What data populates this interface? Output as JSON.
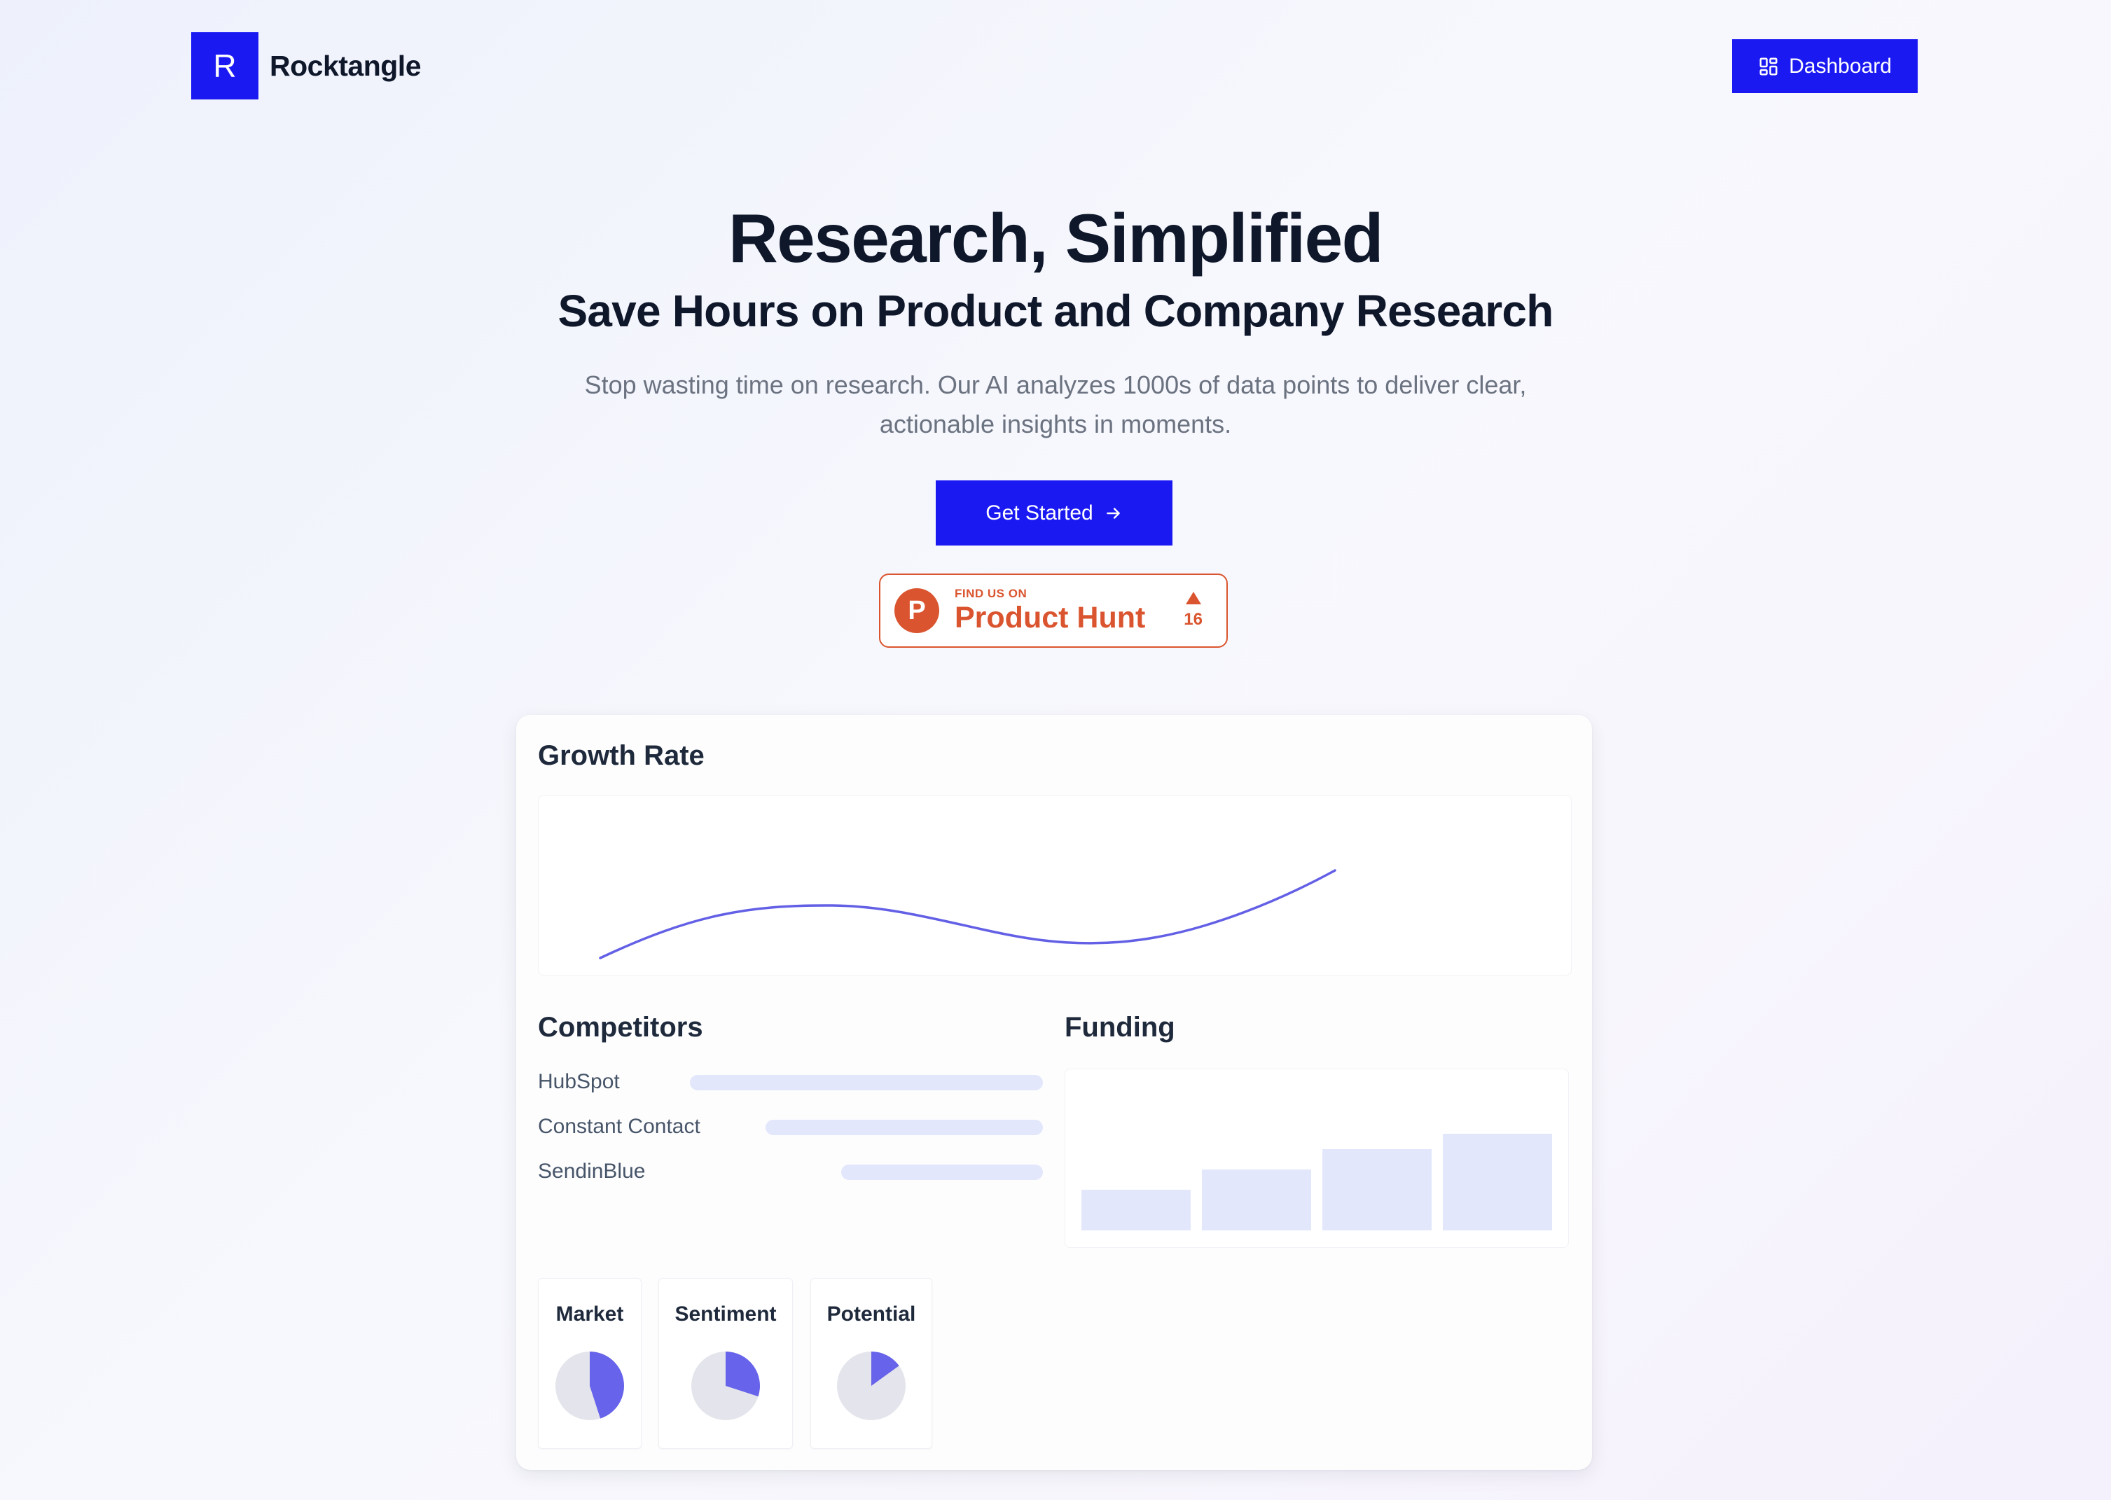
{
  "header": {
    "logo_letter": "R",
    "brand_name": "Rocktangle",
    "dashboard_label": "Dashboard",
    "dashboard_icon": "grid-icon"
  },
  "hero": {
    "title": "Research, Simplified",
    "subtitle": "Save Hours on Product and Company Research",
    "description": "Stop wasting time on research. Our AI analyzes 1000s of data points to deliver clear, actionable insights in moments.",
    "cta_label": "Get Started",
    "cta_icon": "arrow-right-icon"
  },
  "product_hunt": {
    "logo_letter": "P",
    "find_text": "FIND US ON",
    "name": "Product Hunt",
    "votes": "16",
    "color": "#da552f"
  },
  "preview": {
    "growth_title": "Growth Rate",
    "competitors_title": "Competitors",
    "competitors": [
      {
        "name": "HubSpot",
        "bar_fraction": 0.7
      },
      {
        "name": "Constant Contact",
        "bar_fraction": 0.55
      },
      {
        "name": "SendinBlue",
        "bar_fraction": 0.4
      }
    ],
    "funding_title": "Funding",
    "funding_bars": [
      0.43,
      0.64,
      0.85,
      1.0
    ],
    "metrics": [
      {
        "label": "Market",
        "fraction": 0.45
      },
      {
        "label": "Sentiment",
        "fraction": 0.3
      },
      {
        "label": "Potential",
        "fraction": 0.15
      }
    ]
  },
  "colors": {
    "accent": "#1b19f2",
    "chart_line": "#6360e6",
    "pie_fill": "#6763ea",
    "pie_bg": "#e4e5ec",
    "bar_fill": "#e3e7fb"
  }
}
